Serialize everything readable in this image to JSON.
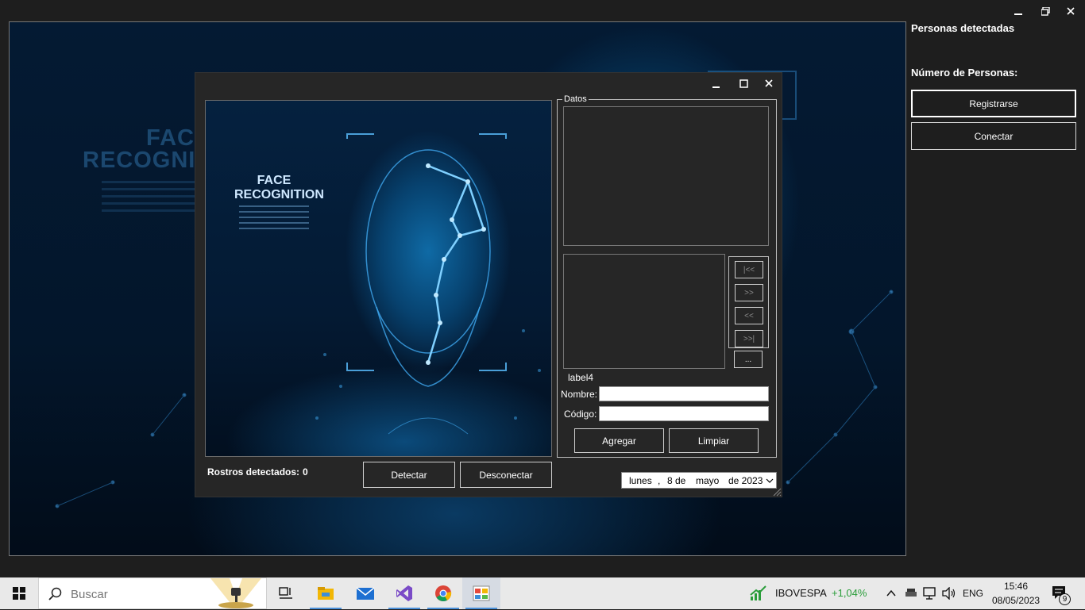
{
  "main_window": {
    "background_title_line1": "FACE",
    "background_title_line2": "RECOGNITION",
    "side_panel": {
      "detected_label": "Personas detectadas",
      "count_label": "Número de Personas:",
      "register_button": "Registrarse",
      "connect_button": "Conectar"
    }
  },
  "dialog": {
    "picture_title_line1": "FACE",
    "picture_title_line2": "RECOGNITION",
    "faces_detected_label": "Rostros detectados:",
    "faces_detected_value": "0",
    "detect_button": "Detectar",
    "disconnect_button": "Desconectar",
    "datos_group": {
      "title": "Datos",
      "nav": {
        "first": "|<<",
        "next": ">>",
        "prev": "<<",
        "last": ">>|",
        "more": "..."
      },
      "label4": "label4",
      "name_label": "Nombre:",
      "name_value": "",
      "code_label": "Código:",
      "code_value": "",
      "add_button": "Agregar",
      "clear_button": "Limpiar"
    },
    "date": {
      "weekday": "lunes",
      "sep": ",",
      "day_text": "8 de",
      "month": "mayo",
      "year_text": "de 2023"
    }
  },
  "taskbar": {
    "search_placeholder": "Buscar",
    "ticker_name": "IBOVESPA",
    "ticker_change": "+1,04%",
    "language": "ENG",
    "time": "15:46",
    "date": "08/05/2023",
    "notification_count": "9",
    "colors": {
      "ticker_positive": "#2a9d3a",
      "accent": "#4a90d9"
    }
  }
}
